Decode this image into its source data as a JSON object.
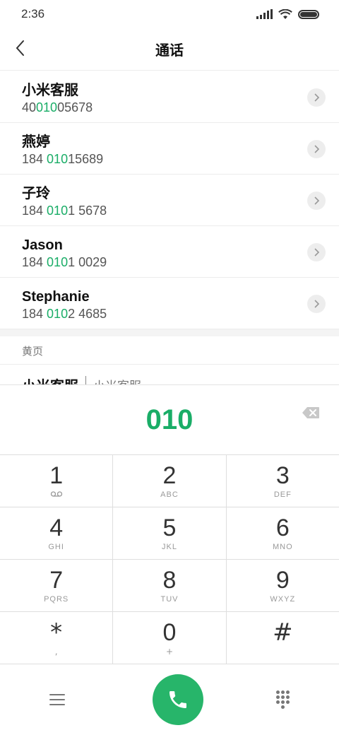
{
  "status_bar": {
    "time": "2:36"
  },
  "header": {
    "title": "通话"
  },
  "results": [
    {
      "name": "小米客服",
      "number_pre": "40",
      "number_hl": "010",
      "number_post": "05678"
    },
    {
      "name": "燕婷",
      "number_pre": "184 ",
      "number_hl": "010",
      "number_post": "15689"
    },
    {
      "name": "子玲",
      "number_pre": "184 ",
      "number_hl": "010",
      "number_post": "1 5678"
    },
    {
      "name": "Jason",
      "number_pre": "184 ",
      "number_hl": "010",
      "number_post": "1 0029"
    },
    {
      "name": "Stephanie",
      "number_pre": "184 ",
      "number_hl": "010",
      "number_post": "2 4685"
    }
  ],
  "yellow_pages": {
    "section_title": "黄页",
    "item_name": "小米客服",
    "item_sub": "小米客服"
  },
  "dial": {
    "entered_digits": "010",
    "keys": [
      [
        {
          "digit": "1",
          "letters": ""
        },
        {
          "digit": "2",
          "letters": "ABC"
        },
        {
          "digit": "3",
          "letters": "DEF"
        }
      ],
      [
        {
          "digit": "4",
          "letters": "GHI"
        },
        {
          "digit": "5",
          "letters": "JKL"
        },
        {
          "digit": "6",
          "letters": "MNO"
        }
      ],
      [
        {
          "digit": "7",
          "letters": "PQRS"
        },
        {
          "digit": "8",
          "letters": "TUV"
        },
        {
          "digit": "9",
          "letters": "WXYZ"
        }
      ],
      [
        {
          "digit": "*",
          "letters": ","
        },
        {
          "digit": "0",
          "letters": "+"
        },
        {
          "digit": "#",
          "letters": ""
        }
      ]
    ]
  },
  "colors": {
    "accent": "#1aad67",
    "call_button": "#27b56a"
  },
  "icons": {
    "back": "chevron-left-icon",
    "detail": "chevron-right-icon",
    "backspace": "backspace-icon",
    "voicemail": "voicemail-icon",
    "menu": "menu-icon",
    "call": "phone-icon",
    "keypad": "dialpad-icon"
  }
}
